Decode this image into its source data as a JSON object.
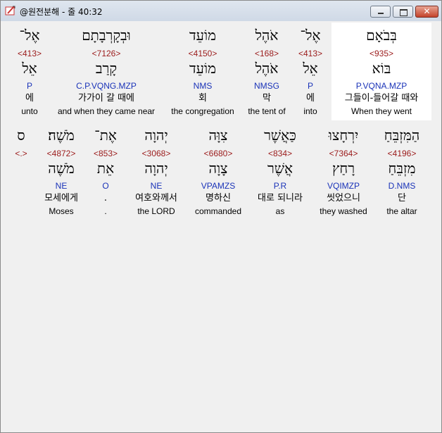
{
  "window": {
    "title": "@원전분해 - 줄 40:32"
  },
  "row1": [
    {
      "hebrew": "אֶל־",
      "strong": "<413>",
      "lemma": "אֵל",
      "morph": "P",
      "korean": "에",
      "english": "unto"
    },
    {
      "hebrew": "וּבְקָרְבָתָם",
      "strong": "<7126>",
      "lemma": "קָרַב",
      "morph": "C.P.VQNG.MZP",
      "korean": "가가이 갈 때에",
      "english": "and when they came near"
    },
    {
      "hebrew": "מוֹעֵד",
      "strong": "<4150>",
      "lemma": "מוֹעֵד",
      "morph": "NMS",
      "korean": "회",
      "english": "the congregation"
    },
    {
      "hebrew": "אֹהֶל",
      "strong": "<168>",
      "lemma": "אֹהֶל",
      "morph": "NMSG",
      "korean": "막",
      "english": "the tent of"
    },
    {
      "hebrew": "אֶל־",
      "strong": "<413>",
      "lemma": "אֵל",
      "morph": "P",
      "korean": "에",
      "english": "into"
    },
    {
      "hebrew": "בְּבֹאָם",
      "strong": "<935>",
      "lemma": "בּוֹא",
      "morph": "P.VQNA.MZP",
      "korean": "그들이-들어갈 때와",
      "english": "When they went"
    }
  ],
  "row2": [
    {
      "hebrew": "ס",
      "strong": "<.>",
      "lemma": "",
      "morph": "",
      "korean": "",
      "english": ""
    },
    {
      "hebrew": "מֹשֶׁה׃",
      "strong": "<4872>",
      "lemma": "מֹשֶׁה",
      "morph": "NE",
      "korean": "모세에게",
      "english": "Moses"
    },
    {
      "hebrew": "אֶת־",
      "strong": "<853>",
      "lemma": "אֵת",
      "morph": "O",
      "korean": ".",
      "english": "."
    },
    {
      "hebrew": "יְהוָה",
      "strong": "<3068>",
      "lemma": "יְהוָה",
      "morph": "NE",
      "korean": "여호와께서",
      "english": "the LORD"
    },
    {
      "hebrew": "צִוָּה",
      "strong": "<6680>",
      "lemma": "צָוָה",
      "morph": "VPAMZS",
      "korean": "명하신",
      "english": "commanded"
    },
    {
      "hebrew": "כַּאֲשֶׁר",
      "strong": "<834>",
      "lemma": "אֲשֶׁר",
      "morph": "P.R",
      "korean": "대로 되니라",
      "english": "as"
    },
    {
      "hebrew": "יִרְחָצוּ",
      "strong": "<7364>",
      "lemma": "רָחַץ",
      "morph": "VQIMZP",
      "korean": "씻었으니",
      "english": "they washed"
    },
    {
      "hebrew": "הַמִּזְבֵּחַ",
      "strong": "<4196>",
      "lemma": "מִזְבֵּחַ",
      "morph": "D.NMS",
      "korean": "단",
      "english": "the altar"
    }
  ]
}
